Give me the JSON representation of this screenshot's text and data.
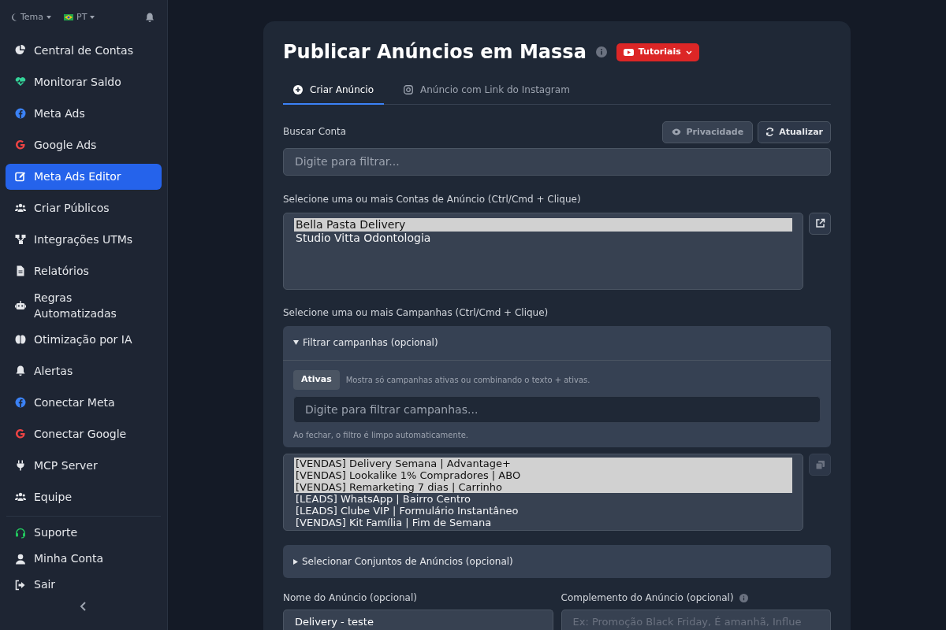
{
  "topbar": {
    "theme": "Tema",
    "language": "PT"
  },
  "sidebar": {
    "items": [
      {
        "label": "Central de Contas",
        "kind": "pie",
        "selected": false
      },
      {
        "label": "Monitorar Saldo",
        "kind": "heart",
        "selected": false
      },
      {
        "label": "Meta Ads",
        "kind": "facebook",
        "selected": false
      },
      {
        "label": "Google Ads",
        "kind": "google",
        "selected": false
      },
      {
        "label": "Meta Ads Editor",
        "kind": "edit",
        "selected": true
      },
      {
        "label": "Criar Públicos",
        "kind": "users",
        "selected": false
      },
      {
        "label": "Integrações UTMs",
        "kind": "network",
        "selected": false
      },
      {
        "label": "Relatórios",
        "kind": "file",
        "selected": false
      },
      {
        "label": "Regras Automatizadas",
        "kind": "robot",
        "selected": false
      },
      {
        "label": "Otimização por IA",
        "kind": "brain",
        "selected": false
      },
      {
        "label": "Alertas",
        "kind": "bell",
        "selected": false
      },
      {
        "label": "Conectar Meta",
        "kind": "facebook",
        "selected": false
      },
      {
        "label": "Conectar Google",
        "kind": "google",
        "selected": false
      },
      {
        "label": "MCP Server",
        "kind": "plug",
        "selected": false
      },
      {
        "label": "Equipe",
        "kind": "users",
        "selected": false
      }
    ],
    "footer": [
      {
        "label": "Suporte",
        "kind": "headset"
      },
      {
        "label": "Minha Conta",
        "kind": "user"
      },
      {
        "label": "Sair",
        "kind": "logout"
      }
    ]
  },
  "page": {
    "title": "Publicar Anúncios em Massa",
    "tutorials_button": "Tutoriais",
    "tabs": [
      {
        "label": "Criar Anúncio",
        "selected": true
      },
      {
        "label": "Anúncio com Link do Instagram",
        "selected": false
      }
    ],
    "search": {
      "label": "Buscar Conta",
      "placeholder": "Digite para filtrar...",
      "privacy_button": "Privacidade",
      "refresh_button": "Atualizar"
    },
    "accounts": {
      "label": "Selecione uma ou mais Contas de Anúncio (Ctrl/Cmd + Clique)",
      "options": [
        {
          "label": "Bella Pasta Delivery",
          "selected": true
        },
        {
          "label": "Studio Vitta Odontologia",
          "selected": false
        }
      ]
    },
    "campaigns": {
      "label": "Selecione uma ou mais Campanhas (Ctrl/Cmd + Clique)",
      "filter": {
        "title": "Filtrar campanhas (opcional)",
        "expanded": true,
        "active_button": "Ativas",
        "active_hint": "Mostra só campanhas ativas ou combinando o texto + ativas.",
        "placeholder": "Digite para filtrar campanhas...",
        "note": "Ao fechar, o filtro é limpo automaticamente."
      },
      "options": [
        {
          "label": "[VENDAS] Delivery Semana | Advantage+",
          "selected": true
        },
        {
          "label": "[VENDAS] Lookalike 1% Compradores | ABO",
          "selected": true
        },
        {
          "label": "[VENDAS] Remarketing 7 dias | Carrinho",
          "selected": true
        },
        {
          "label": "[LEADS] WhatsApp | Bairro Centro",
          "selected": false
        },
        {
          "label": "[LEADS] Clube VIP | Formulário Instantâneo",
          "selected": false
        },
        {
          "label": "[VENDAS] Kit Família | Fim de Semana",
          "selected": false
        }
      ]
    },
    "adsets": {
      "title": "Selecionar Conjuntos de Anúncios (opcional)",
      "expanded": false
    },
    "ad_name": {
      "label": "Nome do Anúncio (opcional)",
      "value": "Delivery - teste"
    },
    "ad_complement": {
      "label": "Complemento do Anúncio (opcional)",
      "placeholder": "Ex: Promoção Black Friday, É amanhã, Influe"
    }
  }
}
